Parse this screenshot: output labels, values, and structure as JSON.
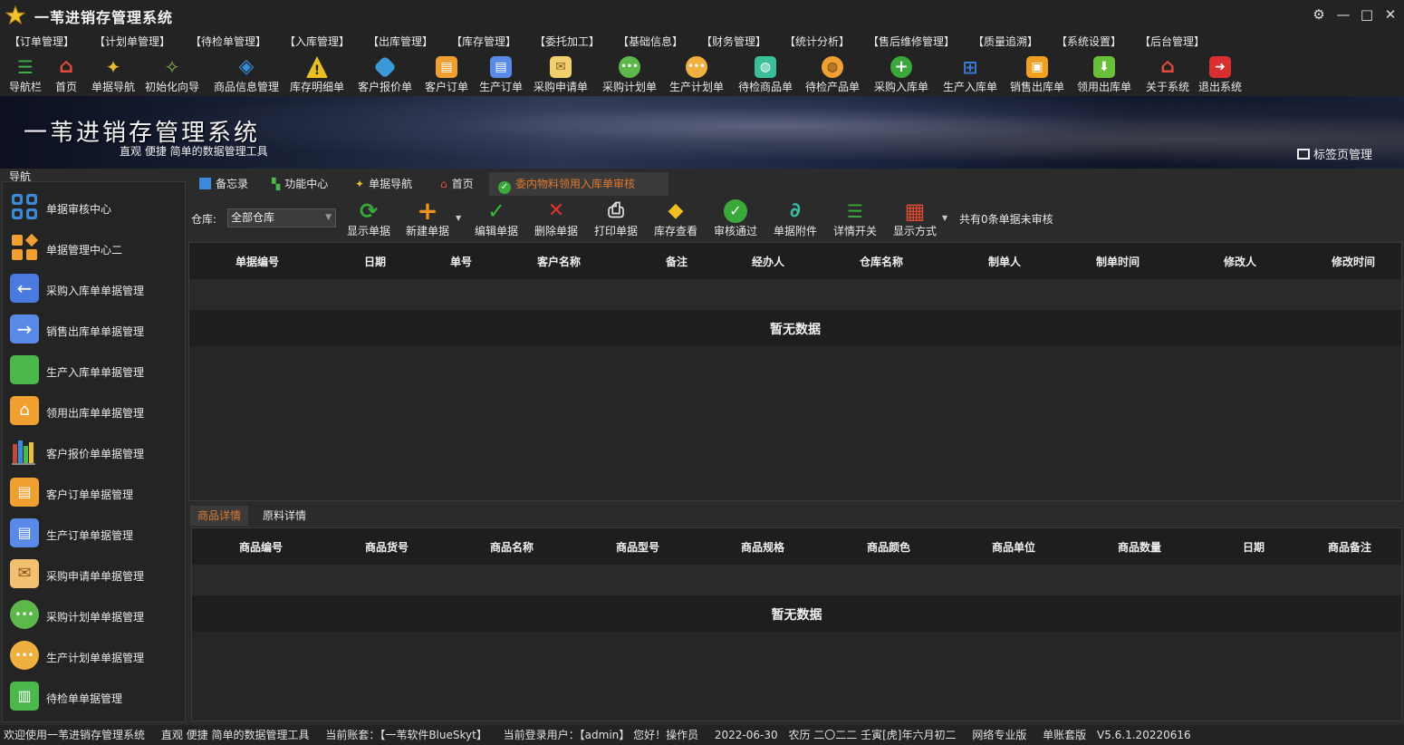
{
  "app": {
    "title": "一苇进销存管理系统",
    "star_color": "#f2c230"
  },
  "window": {
    "settings_icon": "gear-icon",
    "minimize": "—",
    "maximize": "□",
    "close": "✕"
  },
  "menu": [
    "【订单管理】",
    "【计划单管理】",
    "【待检单管理】",
    "【入库管理】",
    "【出库管理】",
    "【库存管理】",
    "【委托加工】",
    "【基础信息】",
    "【财务管理】",
    "【统计分析】",
    "【售后维修管理】",
    "【质量追溯】",
    "【系统设置】",
    "【后台管理】"
  ],
  "toolbar": [
    {
      "label": "导航栏",
      "icon": "menu-icon",
      "color": "#3fae49",
      "glyph": "☰"
    },
    {
      "label": "首页",
      "icon": "home-icon",
      "color": "#e24b3b",
      "glyph": "⌂"
    },
    {
      "label": "单据导航",
      "icon": "pin-icon",
      "color": "#e8b830",
      "glyph": "✦"
    },
    {
      "label": "初始化向导",
      "icon": "wand-icon",
      "color": "#6a9a3a",
      "glyph": "✧"
    },
    {
      "label": "商品信息管理",
      "icon": "cubes-icon",
      "color": "#3a8ad8",
      "glyph": "◈"
    },
    {
      "label": "库存明细单",
      "icon": "warning-icon",
      "color": "#e8c020",
      "glyph": "!"
    },
    {
      "label": "客户报价单",
      "icon": "tag-icon",
      "color": "#3a9ad8",
      "glyph": "◆"
    },
    {
      "label": "客户订单",
      "icon": "document-icon",
      "color": "#f0a030",
      "glyph": "▤"
    },
    {
      "label": "生产订单",
      "icon": "document-icon",
      "color": "#5a8ae8",
      "glyph": "▤"
    },
    {
      "label": "采购申请单",
      "icon": "envelope-icon",
      "color": "#f2d070",
      "glyph": "✉"
    },
    {
      "label": "采购计划单",
      "icon": "chat-icon",
      "color": "#5cb84a",
      "glyph": "•••"
    },
    {
      "label": "生产计划单",
      "icon": "chat-icon",
      "color": "#f0b040",
      "glyph": "•••"
    },
    {
      "label": "待检商品单",
      "icon": "flask-icon",
      "color": "#3abf9a",
      "glyph": "◍"
    },
    {
      "label": "待检产品单",
      "icon": "flask-icon",
      "color": "#f0a030",
      "glyph": "◍"
    },
    {
      "label": "采购入库单",
      "icon": "plus-circle-icon",
      "color": "#3aa83a",
      "glyph": "+"
    },
    {
      "label": "生产入库单",
      "icon": "cart-icon",
      "color": "#3a7ad8",
      "glyph": "⊞"
    },
    {
      "label": "销售出库单",
      "icon": "inbox-icon",
      "color": "#f0a020",
      "glyph": "▣"
    },
    {
      "label": "领用出库单",
      "icon": "download-icon",
      "color": "#6abf3a",
      "glyph": "⬇"
    },
    {
      "label": "关于系统",
      "icon": "house-icon",
      "color": "#e24b3b",
      "glyph": "⌂"
    },
    {
      "label": "退出系统",
      "icon": "exit-icon",
      "color": "#d83030",
      "glyph": "➜"
    }
  ],
  "banner": {
    "title": "一苇进销存管理系统",
    "subtitle": "直观  便捷  简单的数据管理工具",
    "tab_manager": "标签页管理"
  },
  "sidebar": {
    "label": "导航",
    "items": [
      {
        "label": "单据审核中心",
        "color": "#3a8ad8"
      },
      {
        "label": "单据管理中心二",
        "color": "#f0a030"
      },
      {
        "label": "采购入库单单据管理",
        "color": "#4a7ae0"
      },
      {
        "label": "销售出库单单据管理",
        "color": "#5a8ae8"
      },
      {
        "label": "生产入库单单据管理",
        "color": "#4ab84a"
      },
      {
        "label": "领用出库单单据管理",
        "color": "#f0a030"
      },
      {
        "label": "客户报价单单据管理",
        "color": "#c04a3a"
      },
      {
        "label": "客户订单单据管理",
        "color": "#f0a030"
      },
      {
        "label": "生产订单单据管理",
        "color": "#5a8ae8"
      },
      {
        "label": "采购申请单单据管理",
        "color": "#f2c070"
      },
      {
        "label": "采购计划单单据管理",
        "color": "#5cb84a"
      },
      {
        "label": "生产计划单单据管理",
        "color": "#f0b040"
      },
      {
        "label": "待检单单据管理",
        "color": "#4ab84a"
      }
    ]
  },
  "tabs": [
    {
      "label": "备忘录",
      "icon": "memo-icon"
    },
    {
      "label": "功能中心",
      "icon": "apps-icon"
    },
    {
      "label": "单据导航",
      "icon": "pin-icon"
    },
    {
      "label": "首页",
      "icon": "home-icon"
    },
    {
      "label": "委内物料领用入库单审核",
      "icon": "check-circle-icon",
      "active": true
    }
  ],
  "filter": {
    "warehouse_label": "仓库:",
    "warehouse_value": "全部仓库"
  },
  "actions": [
    {
      "label": "显示单据",
      "icon": "refresh-icon",
      "color": "#3aa83a",
      "glyph": "⟳"
    },
    {
      "label": "新建单据",
      "icon": "plus-icon",
      "color": "#f09020",
      "glyph": "+"
    },
    {
      "label": "编辑单据",
      "icon": "check-icon",
      "color": "#3ab83a",
      "glyph": "✓"
    },
    {
      "label": "删除单据",
      "icon": "x-icon",
      "color": "#e03030",
      "glyph": "✕"
    },
    {
      "label": "打印单据",
      "icon": "printer-icon",
      "color": "#dddddd",
      "glyph": "⎙"
    },
    {
      "label": "库存查看",
      "icon": "box-icon",
      "color": "#f0c020",
      "glyph": "◆"
    },
    {
      "label": "审核通过",
      "icon": "check-circle-icon",
      "color": "#3aa83a",
      "glyph": "✓"
    },
    {
      "label": "单据附件",
      "icon": "paperclip-icon",
      "color": "#3abfa0",
      "glyph": "∂"
    },
    {
      "label": "详情开关",
      "icon": "checklist-icon",
      "color": "#3aa83a",
      "glyph": "☰"
    },
    {
      "label": "显示方式",
      "icon": "grid-icon",
      "color": "#e04a30",
      "glyph": "▦"
    }
  ],
  "unreviewed_text": "共有0条单据未审核",
  "grid1": {
    "headers": [
      "单据编号",
      "日期",
      "单号",
      "客户名称",
      "备注",
      "经办人",
      "仓库名称",
      "制单人",
      "制单时间",
      "修改人",
      "修改时间"
    ],
    "empty": "暂无数据"
  },
  "subtabs": [
    "商品详情",
    "原料详情"
  ],
  "grid2": {
    "headers": [
      "商品编号",
      "商品货号",
      "商品名称",
      "商品型号",
      "商品规格",
      "商品颜色",
      "商品单位",
      "商品数量",
      "日期",
      "商品备注"
    ],
    "empty": "暂无数据"
  },
  "status": {
    "welcome": "欢迎使用一苇进销存管理系统",
    "slogan": "直观 便捷 简单的数据管理工具",
    "account": "当前账套：【一苇软件BlueSkyt】",
    "user": "当前登录用户：【admin】 您好！操作员",
    "date": "2022-06-30",
    "lunar": "农历 二〇二二 壬寅[虎]年六月初二",
    "edition": "网络专业版",
    "mode": "单账套版",
    "version": "V5.6.1.20220616"
  }
}
